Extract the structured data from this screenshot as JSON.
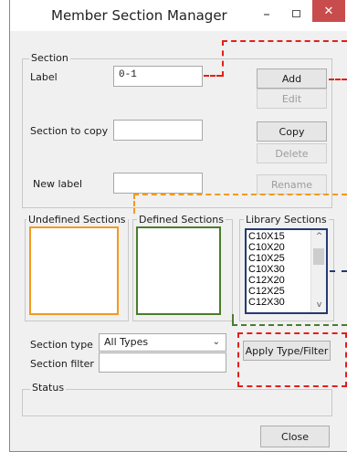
{
  "window": {
    "title": "Member Section Manager",
    "minimize_glyph": "–",
    "close_glyph": "✕"
  },
  "section_group": {
    "title": "Section",
    "label_caption": "Label",
    "label_value": "0-1",
    "section_to_copy_caption": "Section to copy",
    "section_to_copy_value": "",
    "new_label_caption": "New label",
    "new_label_value": ""
  },
  "buttons": {
    "add": "Add",
    "edit": "Edit",
    "copy": "Copy",
    "delete": "Delete",
    "rename": "Rename",
    "apply_type_filter": "Apply Type/Filter",
    "close": "Close"
  },
  "lists": {
    "undefined_title": "Undefined Sections",
    "defined_title": "Defined Sections",
    "library_title": "Library Sections",
    "library_items": [
      "C10X15",
      "C10X20",
      "C10X25",
      "C10X30",
      "C12X20",
      "C12X25",
      "C12X30"
    ]
  },
  "filter": {
    "section_type_caption": "Section type",
    "section_type_value": "All Types",
    "section_filter_caption": "Section filter",
    "section_filter_value": ""
  },
  "status": {
    "title": "Status",
    "text": ""
  },
  "colors": {
    "annotation_red": "#e3201b",
    "annotation_orange": "#f39a1e",
    "annotation_green": "#4a7c2b",
    "annotation_navy": "#233a73"
  }
}
